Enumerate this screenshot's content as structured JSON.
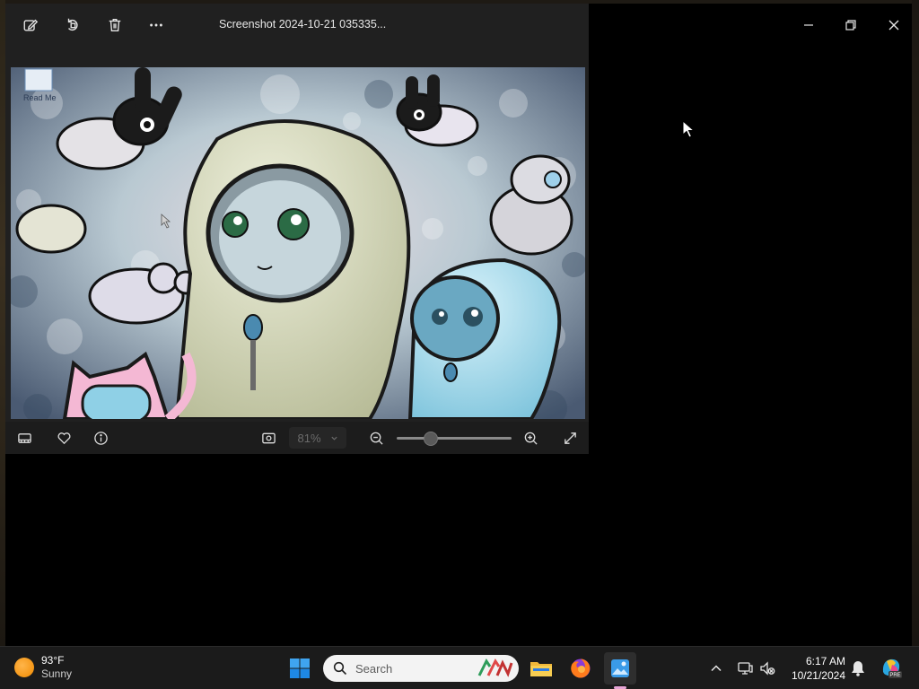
{
  "window": {
    "file_title": "Screenshot 2024-10-21 035335...",
    "minimize_label": "Minimize",
    "maximize_label": "Maximize",
    "close_label": "Close"
  },
  "toolbar": {
    "icons": [
      "edit-icon",
      "rotate-icon",
      "delete-icon",
      "more-icon"
    ]
  },
  "image": {
    "desktop_icon_label": "Read Me"
  },
  "bottom_bar": {
    "zoom_value": "81%",
    "zoom_level_percent": 81
  },
  "taskbar": {
    "weather_temp": "93°F",
    "weather_condition": "Sunny",
    "search_placeholder": "Search",
    "time": "6:17 AM",
    "date": "10/21/2024",
    "copilot_badge": "PRE"
  },
  "colors": {
    "taskbar_bg": "#1b1b1b",
    "viewer_bg": "#202020",
    "accent_indicator": "#e7a5d6"
  }
}
